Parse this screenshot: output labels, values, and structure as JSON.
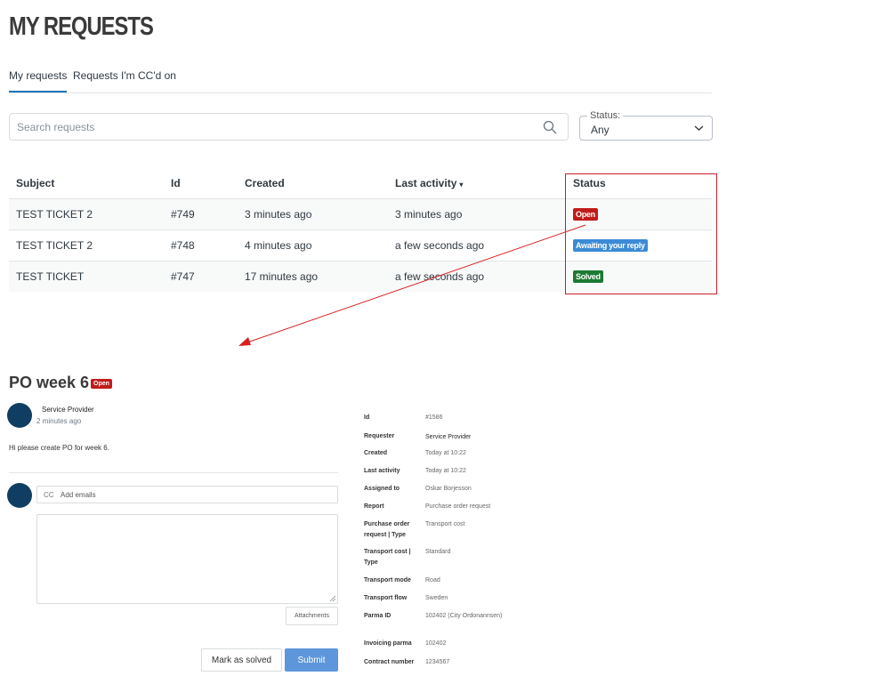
{
  "page": {
    "title": "MY REQUESTS"
  },
  "tabs": [
    {
      "label": "My requests",
      "active": true
    },
    {
      "label": "Requests I'm CC'd on",
      "active": false
    }
  ],
  "search": {
    "placeholder": "Search requests",
    "icon": "search-icon"
  },
  "status_filter": {
    "label": "Status:",
    "value": "Any"
  },
  "table": {
    "columns": [
      "Subject",
      "Id",
      "Created",
      "Last activity",
      "Status"
    ],
    "sort_indicator": "▾",
    "rows": [
      {
        "subject": "TEST TICKET 2",
        "id": "#749",
        "created": "3 minutes ago",
        "last_activity": "3 minutes ago",
        "status": "Open"
      },
      {
        "subject": "TEST TICKET 2",
        "id": "#748",
        "created": "4 minutes ago",
        "last_activity": "a few seconds ago",
        "status": "Awaiting your reply"
      },
      {
        "subject": "TEST TICKET",
        "id": "#747",
        "created": "17 minutes ago",
        "last_activity": "a few seconds ago",
        "status": "Solved"
      }
    ]
  },
  "colors": {
    "open": "#c01b1b",
    "awaiting": "#3b8bd6",
    "solved": "#1c7a33",
    "highlight": "#c8202a",
    "submit": "#5d96db",
    "avatar": "#0f3e62"
  },
  "ticket": {
    "title": "PO week 6",
    "status": "Open",
    "author": "Service Provider",
    "time": "2 minutes ago",
    "comment": "Hi please create PO for week 6.",
    "cc_label": "CC",
    "cc_placeholder": "Add emails",
    "attachments_label": "Attachments",
    "mark_solved_label": "Mark as solved",
    "submit_label": "Submit",
    "properties": [
      {
        "label": "Id",
        "value": "#1586"
      },
      {
        "label": "Requester",
        "value": "Service Provider"
      },
      {
        "label": "Created",
        "value": "Today at 10:22"
      },
      {
        "label": "Last activity",
        "value": "Today at 10:22"
      },
      {
        "label": "Assigned to",
        "value": "Oskar Borjesson"
      },
      {
        "label": "Report",
        "value": "Purchase order request"
      },
      {
        "label": "Purchase order request | Type",
        "value": "Transport cost"
      },
      {
        "label": "Transport cost | Type",
        "value": "Standard"
      },
      {
        "label": "Transport mode",
        "value": "Road"
      },
      {
        "label": "Transport flow",
        "value": "Sweden"
      },
      {
        "label": "Parma ID",
        "value": "102402 (City Ordonannsen)"
      },
      {
        "label": "Invoicing parma",
        "value": "102402"
      },
      {
        "label": "Contract number",
        "value": "1234567"
      }
    ]
  }
}
